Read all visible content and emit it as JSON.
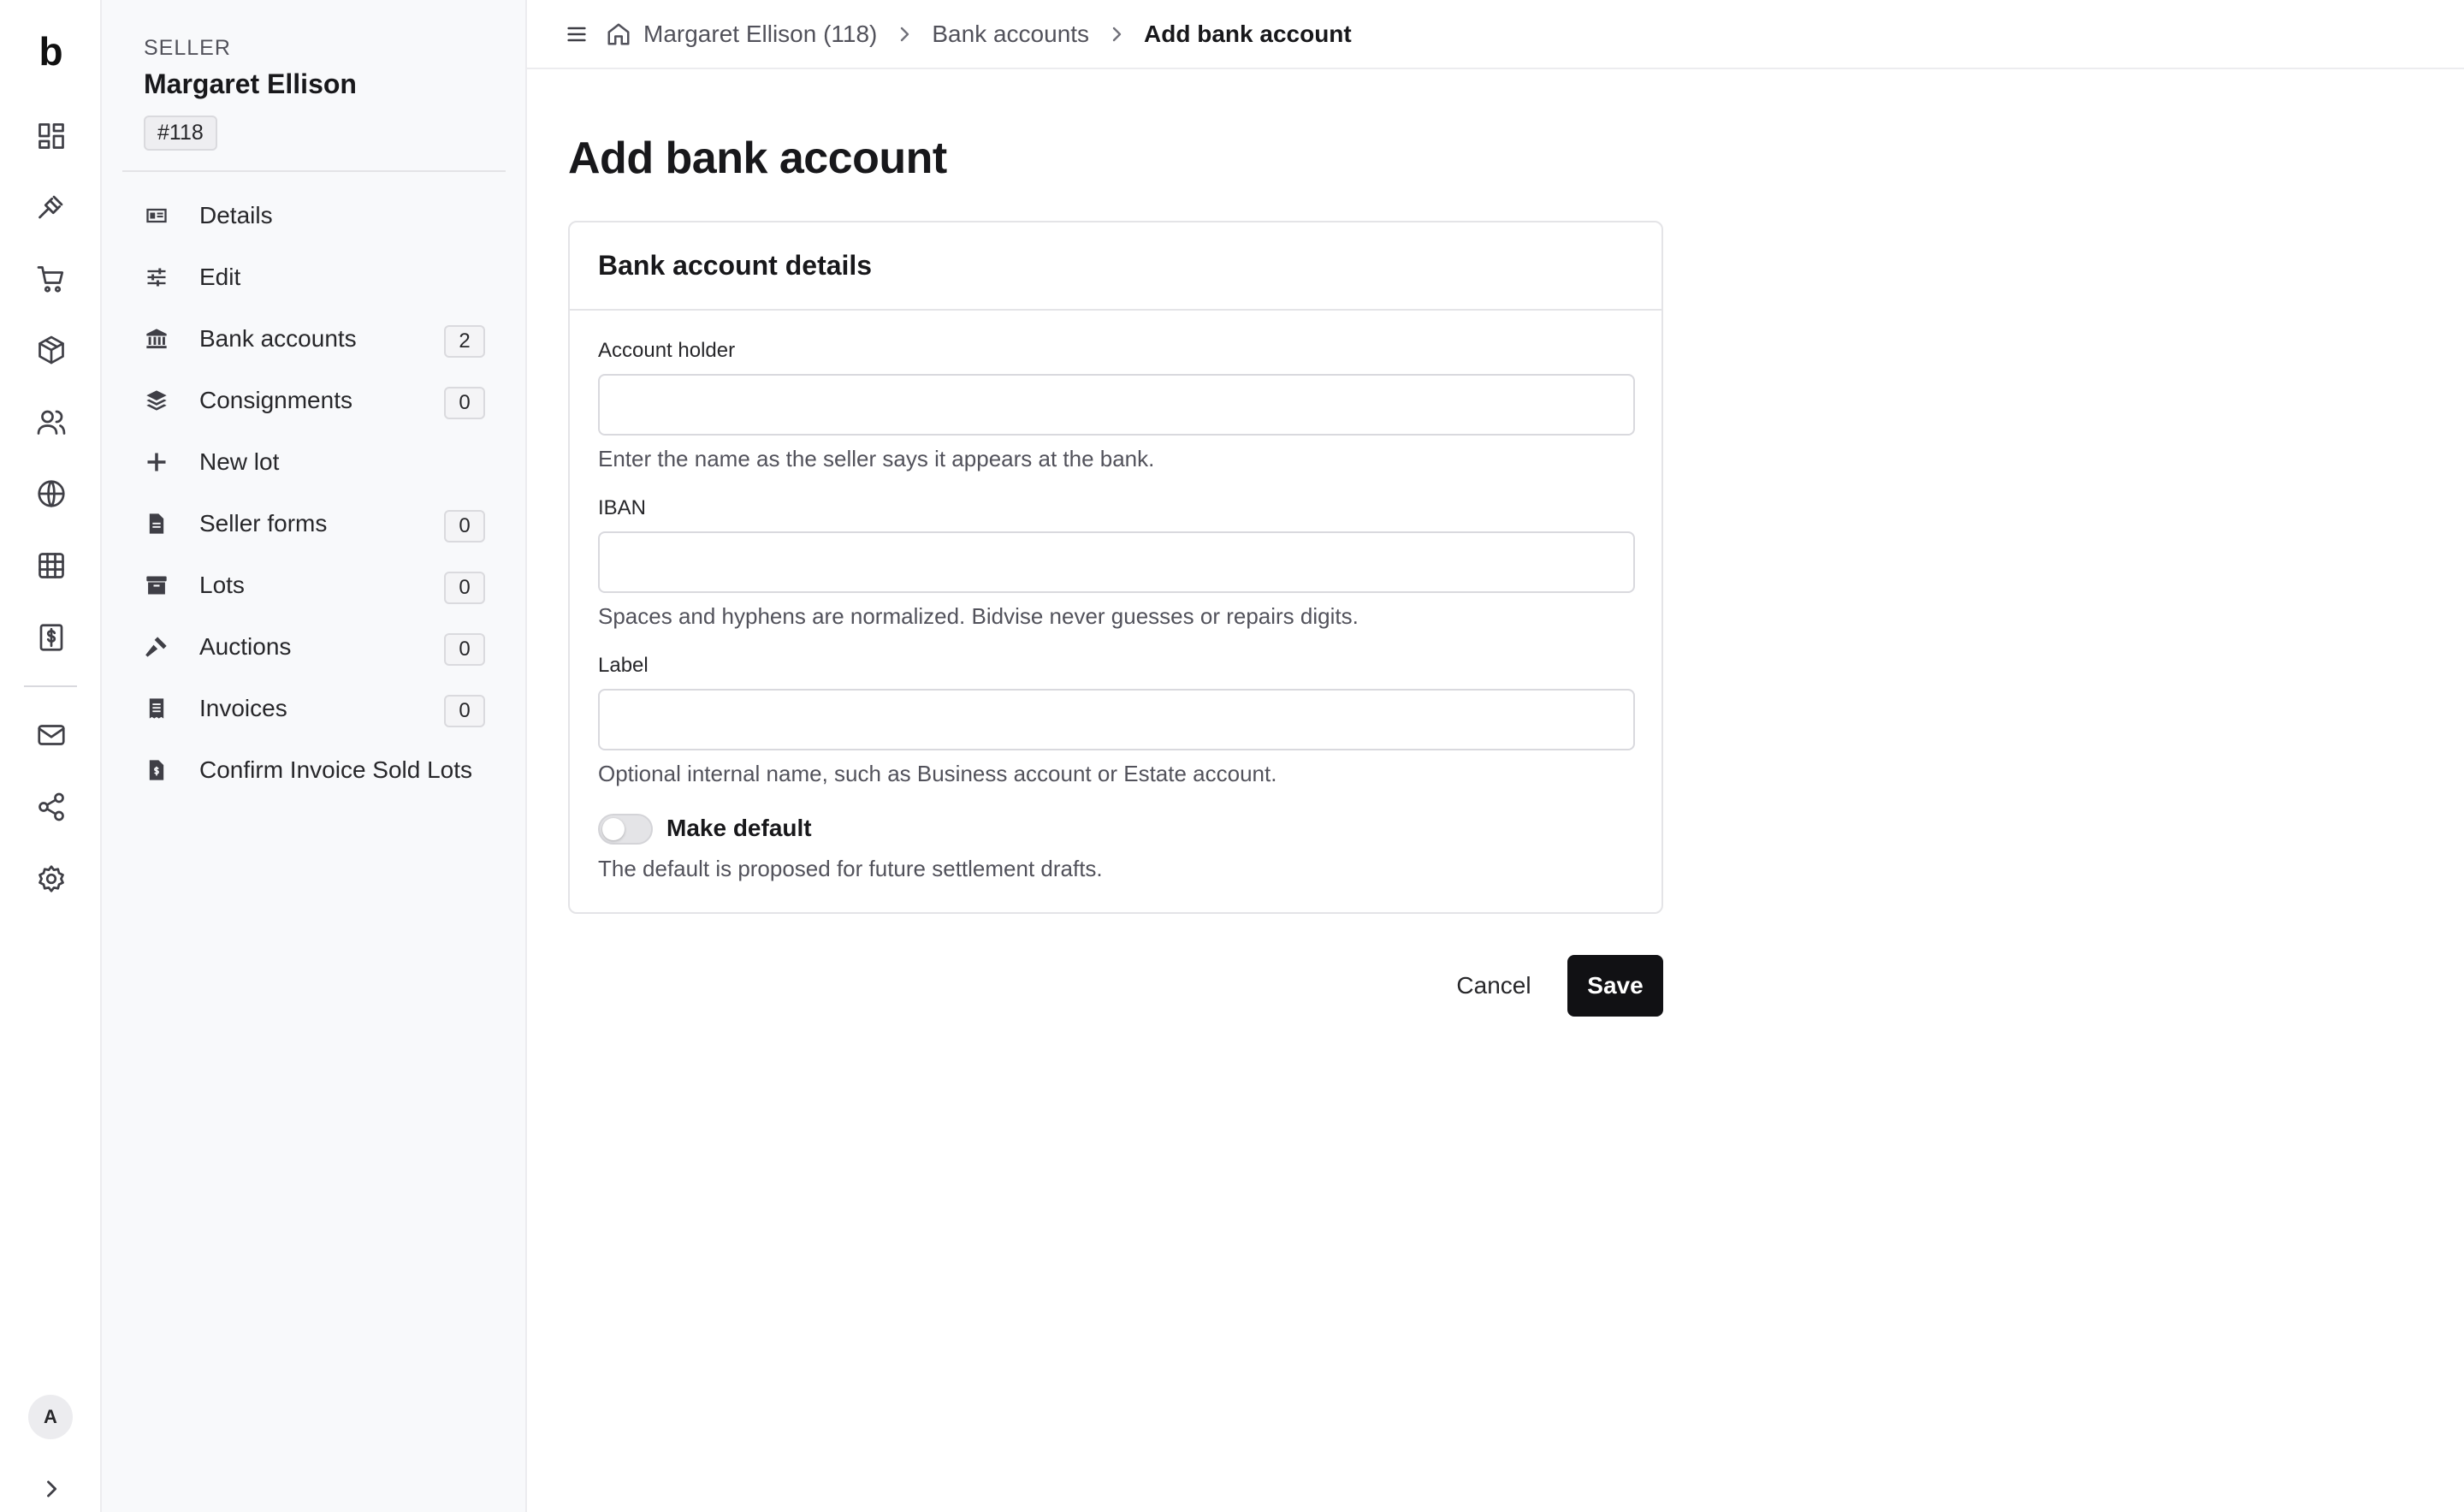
{
  "rail": {
    "logo": "b",
    "items": [
      {
        "icon": "dashboard-icon"
      },
      {
        "icon": "gavel-icon"
      },
      {
        "icon": "cart-icon"
      },
      {
        "icon": "package-icon"
      },
      {
        "icon": "users-icon"
      },
      {
        "icon": "globe-icon"
      },
      {
        "icon": "table-icon"
      },
      {
        "icon": "invoice-dollar-icon"
      },
      {
        "icon": "mail-icon"
      },
      {
        "icon": "share-icon"
      },
      {
        "icon": "gear-icon"
      }
    ],
    "avatar": "A"
  },
  "sidebar": {
    "kicker": "SELLER",
    "name": "Margaret Ellison",
    "id_badge": "#118",
    "items": [
      {
        "label": "Details",
        "icon": "id-card-icon",
        "badge": ""
      },
      {
        "label": "Edit",
        "icon": "sliders-icon",
        "badge": ""
      },
      {
        "label": "Bank accounts",
        "icon": "bank-icon",
        "badge": "2"
      },
      {
        "label": "Consignments",
        "icon": "layers-icon",
        "badge": "0"
      },
      {
        "label": "New lot",
        "icon": "plus-icon",
        "badge": ""
      },
      {
        "label": "Seller forms",
        "icon": "document-icon",
        "badge": "0"
      },
      {
        "label": "Lots",
        "icon": "archive-icon",
        "badge": "0"
      },
      {
        "label": "Auctions",
        "icon": "gavel-icon",
        "badge": "0"
      },
      {
        "label": "Invoices",
        "icon": "receipt-icon",
        "badge": "0"
      },
      {
        "label": "Confirm Invoice Sold Lots",
        "icon": "document-dollar-icon",
        "badge": ""
      }
    ]
  },
  "breadcrumb": {
    "home": "Margaret Ellison (118)",
    "middle": "Bank accounts",
    "current": "Add bank account"
  },
  "page": {
    "title": "Add bank account"
  },
  "form": {
    "section_title": "Bank account details",
    "account_holder": {
      "label": "Account holder",
      "value": "",
      "help": "Enter the name as the seller says it appears at the bank."
    },
    "iban": {
      "label": "IBAN",
      "value": "",
      "help": "Spaces and hyphens are normalized. Bidvise never guesses or repairs digits."
    },
    "label_field": {
      "label": "Label",
      "value": "",
      "help": "Optional internal name, such as Business account or Estate account."
    },
    "make_default": {
      "label": "Make default",
      "checked": false,
      "help": "The default is proposed for future settlement drafts."
    }
  },
  "actions": {
    "cancel": "Cancel",
    "save": "Save"
  }
}
